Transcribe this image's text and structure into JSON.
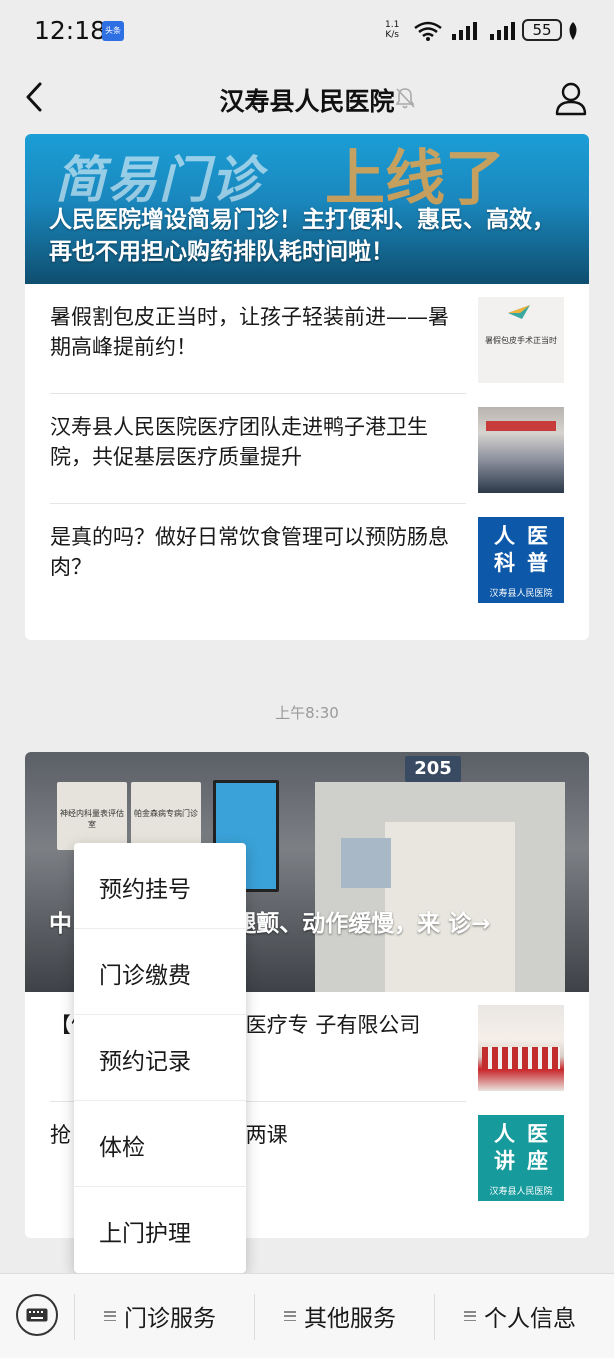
{
  "status_bar": {
    "time": "12:18",
    "badge": "头条",
    "net_speed_top": "1.1",
    "net_speed_unit": "K/s",
    "battery": "55"
  },
  "nav": {
    "title": "汉寿县人民医院"
  },
  "card1": {
    "banner_text": "简易门诊",
    "banner_accent": "上线了",
    "hero_title": "人民医院增设简易门诊！主打便利、惠民、高效，再也不用担心购药排队耗时间啦！",
    "items": [
      {
        "title": "暑假割包皮正当时，让孩子轻装前进——暑期高峰提前约！",
        "thumb_text": "暑假包皮手术正当时"
      },
      {
        "title": "汉寿县人民医院医疗团队走进鸭子港卫生院，共促基层医疗质量提升"
      },
      {
        "title": "是真的吗？做好日常饮食管理可以预防肠息肉？",
        "thumb_chars": [
          "人",
          "医",
          "科",
          "普"
        ],
        "thumb_foot": "汉寿县人民医院"
      }
    ]
  },
  "timestamp": "上午8:30",
  "card2": {
    "room_number": "205",
    "plaque1": "神经内科量表评估室",
    "plaque2": "帕金森病专病门诊",
    "hero_title": "中 “ 杀手”！手抖腿颤、动作缓慢，来 诊→",
    "items": [
      {
        "title": "【健 汉寿县人民医院医疗专 子有限公司"
      },
      {
        "title": "抢 月健康讲堂，每周两课",
        "thumb_chars": [
          "人",
          "医",
          "讲",
          "座"
        ],
        "thumb_foot": "汉寿县人民医院"
      }
    ]
  },
  "popup_menu": {
    "items": [
      "预约挂号",
      "门诊缴费",
      "预约记录",
      "体检",
      "上门护理"
    ]
  },
  "bottom_bar": {
    "menus": [
      "门诊服务",
      "其他服务",
      "个人信息"
    ]
  },
  "colors": {
    "background": "#ededed",
    "card": "#ffffff",
    "hero_blue": "#1a87bd",
    "thumb_blue": "#0d58a8",
    "thumb_teal": "#169a9c"
  },
  "icons": [
    "back-arrow-icon",
    "mute-bell-icon",
    "profile-icon",
    "keyboard-icon",
    "hamburger-icon",
    "wifi-icon",
    "signal-icon",
    "battery-icon"
  ]
}
